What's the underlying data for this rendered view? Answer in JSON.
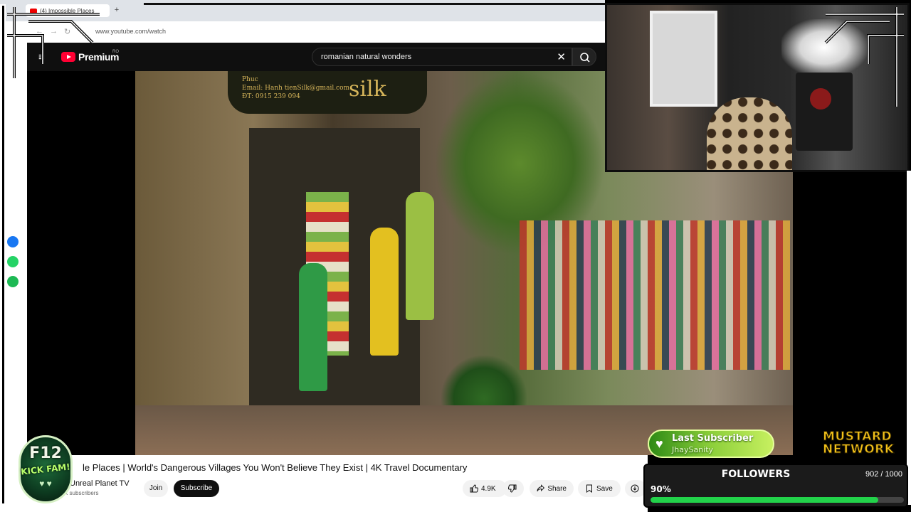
{
  "browser": {
    "tab_title": "(4) Impossible Places",
    "new_tab": "+",
    "url": "www.youtube.com/watch"
  },
  "youtube": {
    "logo_text": "Premium",
    "region": "RO",
    "search_value": "romanian natural wonders",
    "search_clear": "✕"
  },
  "video_sign": {
    "line1": "Phuc",
    "line2": "Email: Hanh tienSilk@gmail.com",
    "line3": "ĐT: 0915 239 094",
    "brand": "silk"
  },
  "video_info": {
    "title": "le Places | World's Dangerous Villages You Won't Believe They Exist | 4K Travel Documentary",
    "channel": "Unreal Planet TV",
    "subscribers": "K subscribers",
    "join": "Join",
    "subscribe": "Subscribe",
    "likes": "4.9K",
    "share": "Share",
    "save": "Save"
  },
  "overlay": {
    "f12_top": "F12",
    "f12_mid": "KICK FAM!",
    "f12_hearts": "♥ ♥",
    "last_subscriber_title": "Last Subscriber",
    "last_subscriber_name": "JhaySanity",
    "mustard_line1": "MUSTARD",
    "mustard_line2": "NETWORK",
    "followers_title": "FOLLOWERS",
    "followers_count": "902 / 1000",
    "followers_percent": "90%",
    "followers_progress": 0.9
  },
  "colors": {
    "yt_red": "#ff0033",
    "progress_green": "#22d24a",
    "mustard_yellow": "#f3c21a"
  }
}
